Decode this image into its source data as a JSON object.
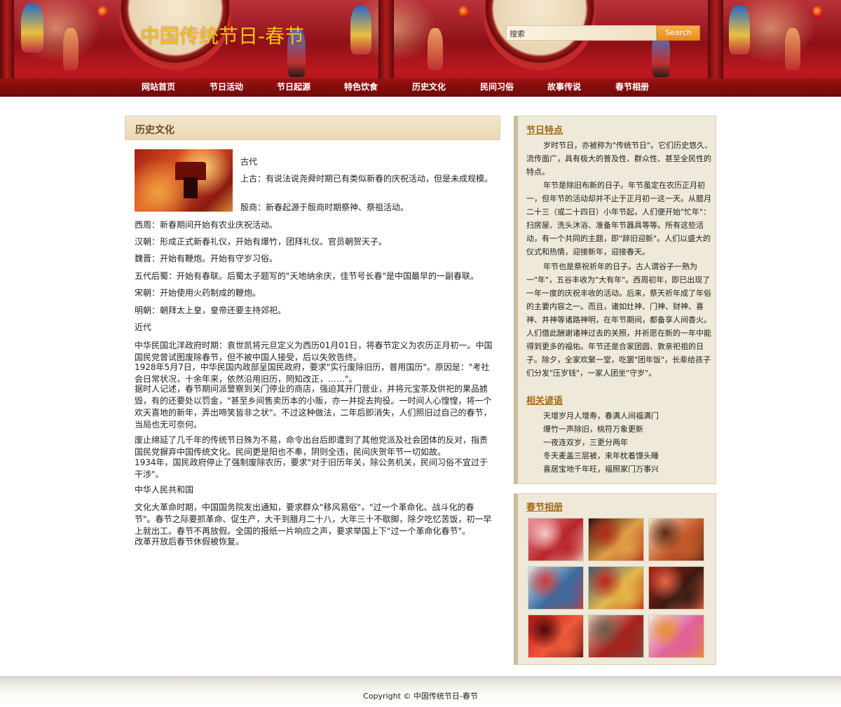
{
  "header": {
    "site_title": "中国传统节日-春节",
    "search_placeholder": "搜索",
    "search_button": "Search"
  },
  "nav": [
    "网站首页",
    "节日活动",
    "节日起源",
    "特色饮食",
    "历史文化",
    "民间习俗",
    "故事传说",
    "春节相册"
  ],
  "main": {
    "heading": "历史文化",
    "intro": {
      "era": "古代",
      "p1": "上古：有说法说尧舜时期已有类似新春的庆祝活动，但是未成规模。",
      "p2": "殷商：新春起源于殷商时期祭神、祭祖活动。"
    },
    "paragraphs": [
      "西周：新春期间开始有农业庆祝活动。",
      "汉朝：形成正式新春礼仪，开始有爆竹，团拜礼仪。官员朝贺天子。",
      "魏晋：开始有鞭炮。开始有守岁习俗。",
      "五代后蜀：开始有春联。后蜀太子题写的\"天地纳余庆，佳节号长春\"是中国最早的一副春联。",
      "宋朝：开始使用火药制成的鞭炮。",
      "明朝：朝拜太上皇，皇帝还要主持郊祀。",
      "近代",
      "中华民国北洋政府时期：袁世凯将元旦定义为西历01月01日，将春节定义为农历正月初一。中国国民党曾试图废除春节，但不被中国人接受，后以失败告终。",
      "1928年5月7日，中华民国内政部呈国民政府，要求\"实行废除旧历，普用国历\"。原因是：\"考社会日常状况，十余年来，依然沿用旧历，罔知改正，……\"。",
      "据时人记述，春节期间派警察到关门停业的商店，强迫其开门营业，并将元宝茶及供祀的果品掳毁，有的还要处以罚金，\"甚至乡间售卖历本的小贩，亦一并捉去拘役。一时间人心惶惶，将一个欢天喜地的新年，弄出啼笑皆非之状\"。不过这种做法，二年后即消失，人们照旧过自己的春节，当局也无可奈何。",
      "废止绵延了几千年的传统节日殊为不易，命令出台后即遭到了其他党派及社会团体的反对，指责国民党摒弃中国传统文化。民间更是阳也不奉，阴则全违，民间庆贺年节一切如故。",
      "1934年，国民政府停止了强制废除农历，要求\"对于旧历年关，除公务机关，民间习俗不宜过于干涉\"。",
      "中华人民共和国",
      "文化大革命时期，中国国务院发出通知，要求群众\"移风易俗\"，\"过一个革命化、战斗化的春节\"。春节之际要抓革命、促生产，大干到腊月二十八，大年三十不歇脚，除夕吃忆苦饭，初一早上就出工。春节不再放假。全国的报纸一片响应之声，要求举国上下\"过一个革命化春节\"。",
      "改革开放后春节休假被恢复。"
    ]
  },
  "sidebar": {
    "features": {
      "title": "节日特点",
      "paragraphs": [
        "岁时节日，亦被称为\"传统节日\"。它们历史悠久、流传面广，具有极大的普及性、群众性、甚至全民性的特点。",
        "年节是除旧布新的日子。年节虽定在农历正月初一，但年节的活动却并不止于正月初一这一天。从腊月二十三（或二十四日）小年节起，人们便开始\"忙年\"：扫房屋、洗头沐浴、准备年节器具等等。所有这些活动，有一个共同的主题，即\"辞旧迎新\"。人们以盛大的仪式和热情，迎接新年，迎接春天。",
        "年节也是祭祝祈年的日子。古人谓谷子一熟为一\"年\"，五谷丰收为\"大有年\"。西周初年，即已出现了一年一度的庆祝丰收的活动。后来，祭天祈年成了年俗的主要内容之一。而且，诸如灶神、门神、财神、喜神、井神等诸路神明，在年节期间，都备享人间香火。人们借此酬谢诸神过去的关照，并祈愿在新的一年中能得到更多的福佑。年节还是合家团圆、敦亲祀祖的日子。除夕，全家欢聚一堂，吃罢\"团年饭\"，长辈给孩子们分发\"压岁钱\"，一家人团坐\"守岁\"。"
      ]
    },
    "couplets": {
      "title": "相关谚语",
      "lines": [
        "天增岁月人增寿，春满人间福满门",
        "爆竹一声除旧，桃符万象更新",
        "一夜连双岁，三更分两年",
        "冬天麦盖三层被，来年枕着馒头睡",
        "喜居宝地千年旺，福照家门万事兴"
      ]
    },
    "album": {
      "title": "春节相册",
      "photos": [
        {
          "name": "photo-market",
          "colors": [
            "#e98a9a",
            "#b8242a",
            "#f7c9c2"
          ]
        },
        {
          "name": "photo-night-lights",
          "colors": [
            "#2a1208",
            "#e0a048",
            "#b0281a"
          ]
        },
        {
          "name": "photo-painting",
          "colors": [
            "#f2e0c0",
            "#c85a2a",
            "#5c2a18"
          ]
        },
        {
          "name": "photo-kids",
          "colors": [
            "#d8e4ec",
            "#3a6aa0",
            "#d03a3a"
          ]
        },
        {
          "name": "photo-dragon-dance",
          "colors": [
            "#3c5a80",
            "#e4b84a",
            "#c02818"
          ]
        },
        {
          "name": "photo-red-doors",
          "colors": [
            "#b01c18",
            "#3a1a12",
            "#e86a4a"
          ]
        },
        {
          "name": "photo-lanterns",
          "colors": [
            "#c2141a",
            "#f05a3a",
            "#4a0a0a"
          ]
        },
        {
          "name": "photo-street",
          "colors": [
            "#d8c8b0",
            "#a8201c",
            "#6a5a4a"
          ]
        },
        {
          "name": "photo-nianhua",
          "colors": [
            "#f4eaec",
            "#e0609a",
            "#e8902a"
          ]
        }
      ]
    }
  },
  "footer": {
    "copyright": "Copyright © 中国传统节日-春节"
  },
  "colors": {
    "title_gold": "#f7c21a",
    "header_red": "#8f1018",
    "sidebar_bg": "#efe9d9",
    "sidebar_title": "#a36a17",
    "heading_brown": "#6b4a2a"
  }
}
